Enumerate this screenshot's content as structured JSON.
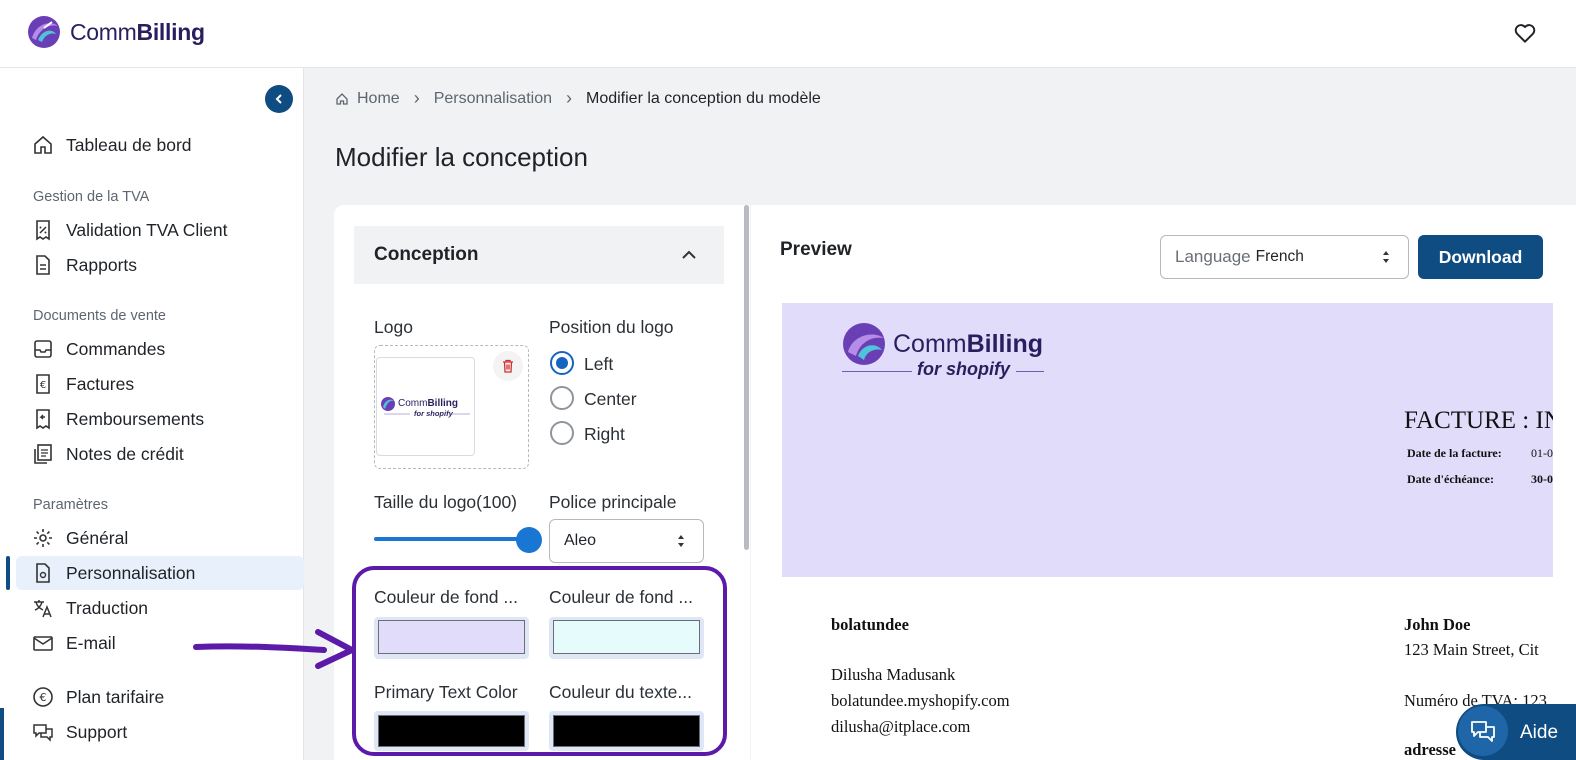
{
  "app": {
    "brand_regular": "Comm",
    "brand_bold": "Billing"
  },
  "sidebar": {
    "dashboard": "Tableau de bord",
    "section_vat": "Gestion de la TVA",
    "vat_validation": "Validation TVA Client",
    "reports": "Rapports",
    "section_sales": "Documents de vente",
    "orders": "Commandes",
    "invoices": "Factures",
    "refunds": "Remboursements",
    "credit_notes": "Notes de crédit",
    "section_settings": "Paramètres",
    "general": "Général",
    "customization": "Personnalisation",
    "translation": "Traduction",
    "email": "E-mail",
    "pricing": "Plan tarifaire",
    "support": "Support"
  },
  "breadcrumb": {
    "home": "Home",
    "customization": "Personnalisation",
    "current": "Modifier la conception du modèle"
  },
  "page_title": "Modifier la conception",
  "design_panel": {
    "accordion_title": "Conception",
    "logo_label": "Logo",
    "logo_position_label": "Position du logo",
    "position_options": [
      "Left",
      "Center",
      "Right"
    ],
    "position_selected": "Left",
    "logo_size_label": "Taille du logo(100)",
    "logo_size_value": 100,
    "main_font_label": "Police principale",
    "main_font_value": "Aleo",
    "bg_color_1_label": "Couleur de fond ...",
    "bg_color_1": "#e2dcfb",
    "bg_color_2_label": "Couleur de fond ...",
    "bg_color_2": "#e6fbfb",
    "primary_text_label": "Primary Text Color",
    "primary_text_color": "#000000",
    "secondary_text_label": "Couleur du texte...",
    "secondary_text_color": "#000000"
  },
  "preview": {
    "title": "Preview",
    "language_key": "Language",
    "language_value": "French",
    "download": "Download",
    "logo_brand_regular": "Comm",
    "logo_brand_bold": "Billing",
    "logo_tagline": "for shopify",
    "invoice_title": "FACTURE : IN",
    "invoice_date_label": "Date de la facture:",
    "invoice_date_value": "01-0",
    "due_date_label": "Date d'échéance:",
    "due_date_value": "30-0",
    "seller_name": "bolatundee",
    "seller_contact": "Dilusha Madusank",
    "seller_domain": "bolatundee.myshopify.com",
    "seller_email": "dilusha@itplace.com",
    "buyer_name": "John Doe",
    "buyer_address": "123 Main Street, Cit",
    "buyer_vat": "Numéro de TVA: 123",
    "address_heading": "adresse"
  },
  "help": {
    "label": "Aide"
  },
  "colors": {
    "primary": "#0f4c81",
    "annotation": "#5b1aa8"
  }
}
